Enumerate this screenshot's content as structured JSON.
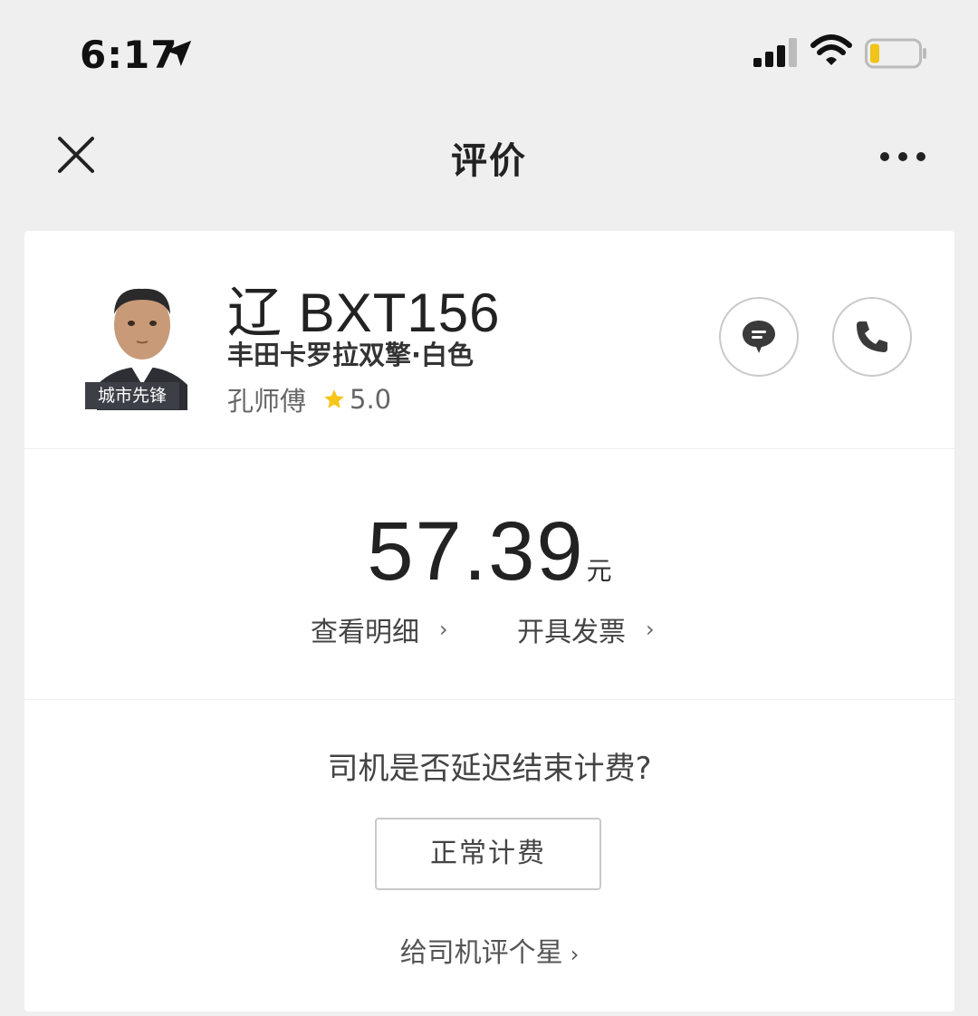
{
  "status_bar": {
    "time": "6:17",
    "icons": [
      "location-arrow-icon",
      "cellular-signal-icon",
      "wifi-icon",
      "battery-low-icon"
    ]
  },
  "nav": {
    "title": "评价",
    "close_icon": "close-icon",
    "more_icon": "more-icon"
  },
  "driver": {
    "plate": "辽 BXT156",
    "car_model": "丰田卡罗拉双擎·白色",
    "name": "孔师傅",
    "rating": "5.0",
    "badge": "城市先锋",
    "actions": [
      "chat-icon",
      "phone-icon"
    ]
  },
  "fare": {
    "amount": "57.39",
    "unit": "元",
    "detail_link": "查看明细",
    "invoice_link": "开具发票",
    "chevron": "›"
  },
  "feedback": {
    "question": "司机是否延迟结束计费?",
    "normal_button": "正常计费",
    "rate_link": "给司机评个星",
    "chevron": "›"
  },
  "colors": {
    "background": "#efefef",
    "card": "#ffffff",
    "star": "#f5c518",
    "battery": "#f0c419"
  }
}
